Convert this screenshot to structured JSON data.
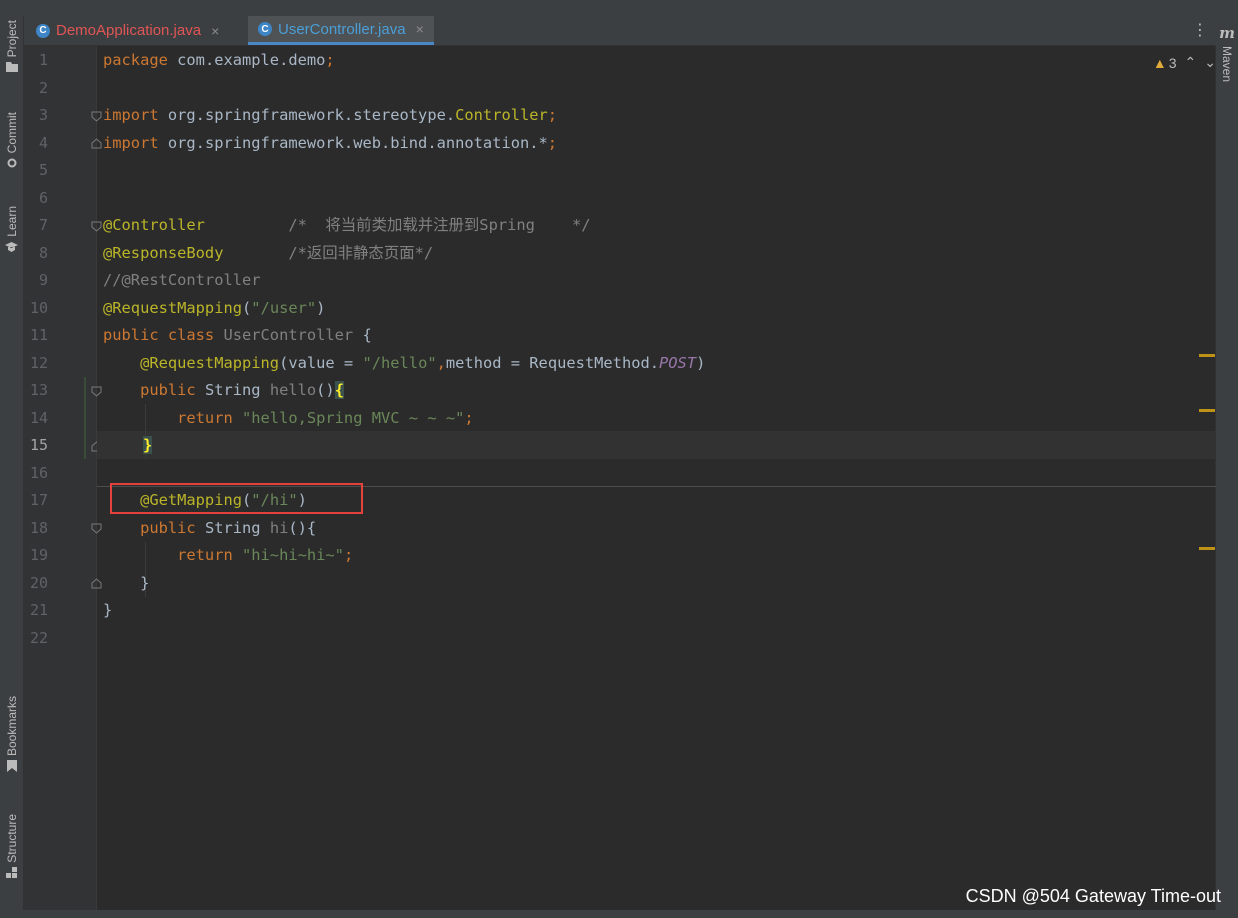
{
  "tabs": [
    {
      "label": "DemoApplication.java",
      "icon": "class-icon",
      "color": "#e05555",
      "active": false
    },
    {
      "label": "UserController.java",
      "icon": "class-icon",
      "color": "#4a9fd8",
      "active": true
    }
  ],
  "tab_close_glyph": "×",
  "tab_menu_glyph": "⋮",
  "left_tools": [
    "Project",
    "Commit",
    "Learn",
    "Bookmarks",
    "Structure"
  ],
  "right_tools": {
    "logo": "m",
    "label": "Maven"
  },
  "inspections": {
    "warnings": "3",
    "up": "⌃",
    "down": "⌄"
  },
  "current_line": "15",
  "line_numbers": [
    "1",
    "2",
    "3",
    "4",
    "5",
    "6",
    "7",
    "8",
    "9",
    "10",
    "11",
    "12",
    "13",
    "14",
    "15",
    "16",
    "17",
    "18",
    "19",
    "20",
    "21",
    "22"
  ],
  "code": {
    "l1_kw": "package",
    "l1_rest": " com.example.demo",
    "l1_semi": ";",
    "l3_kw": "import",
    "l3_rest": " org.springframework.stereotype.",
    "l3_cls": "Controller",
    "l3_semi": ";",
    "l4_kw": "import",
    "l4_rest": " org.springframework.web.bind.annotation.*",
    "l4_semi": ";",
    "l7_ann": "@Controller",
    "l7_cmt": "         /*  将当前类加载并注册到Spring    */",
    "l8_ann": "@ResponseBody",
    "l8_cmt": "       /*返回非静态页面*/",
    "l9_cmt": "//@RestController",
    "l10_ann": "@RequestMapping",
    "l10_p1": "(",
    "l10_str": "\"/user\"",
    "l10_p2": ")",
    "l11_kw": "public class",
    "l11_name": " UserController",
    "l11_rest": " {",
    "l12_ann": "    @RequestMapping",
    "l12_p1": "(value = ",
    "l12_str": "\"/hello\"",
    "l12_comma": ",",
    "l12_p2": "method = RequestMethod.",
    "l12_const": "POST",
    "l12_p3": ")",
    "l13_kw": "    public",
    "l13_type": " String",
    "l13_name": " hello",
    "l13_paren": "()",
    "l13_brace": "{",
    "l14_kw": "        return",
    "l14_str": " \"hello,Spring MVC ~ ~ ~\"",
    "l14_semi": ";",
    "l15_brace": "}",
    "l17_ann": "    @GetMapping",
    "l17_p1": "(",
    "l17_str": "\"/hi\"",
    "l17_p2": ")",
    "l18_kw": "    public",
    "l18_type": " String",
    "l18_name": " hi",
    "l18_rest": "(){",
    "l19_kw": "        return",
    "l19_str": " \"hi~hi~hi~\"",
    "l19_semi": ";",
    "l20": "    }",
    "l21": "}"
  },
  "watermark": "CSDN @504 Gateway Time-out"
}
